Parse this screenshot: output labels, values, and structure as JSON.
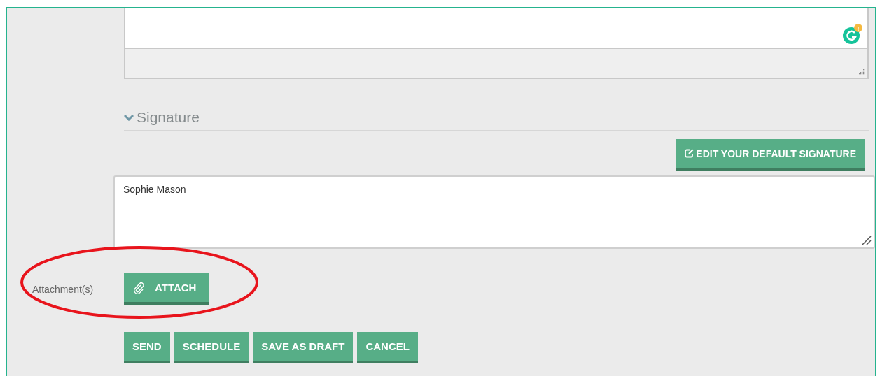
{
  "editor": {
    "grammar_badge": "!"
  },
  "signature": {
    "title": "Signature",
    "expanded": true,
    "edit_button": "EDIT YOUR DEFAULT SIGNATURE",
    "text": "Sophie Mason"
  },
  "attachments": {
    "label": "Attachment(s)",
    "button": "ATTACH"
  },
  "actions": [
    "SEND",
    "SCHEDULE",
    "SAVE AS DRAFT",
    "CANCEL"
  ]
}
